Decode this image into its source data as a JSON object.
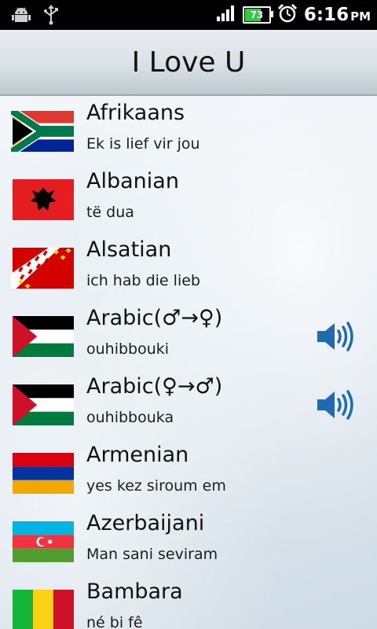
{
  "status_bar": {
    "time": "6:16",
    "ampm": "PM",
    "battery_level": "73",
    "icons": [
      "android-debug-icon",
      "usb-icon",
      "signal-icon",
      "battery-icon",
      "alarm-icon"
    ]
  },
  "app": {
    "title": "I Love U"
  },
  "languages": [
    {
      "name": "Afrikaans",
      "phrase": "Ek is lief vir jou",
      "flag": "south-africa",
      "audio": false
    },
    {
      "name": "Albanian",
      "phrase": "të dua",
      "flag": "albania",
      "audio": false
    },
    {
      "name": "Alsatian",
      "phrase": "ich hab die lieb",
      "flag": "alsace",
      "audio": false
    },
    {
      "name": "Arabic(♂→♀)",
      "phrase": "ouhibbouki",
      "flag": "palestine",
      "audio": true
    },
    {
      "name": "Arabic(♀→♂)",
      "phrase": "ouhibbouka",
      "flag": "palestine",
      "audio": true
    },
    {
      "name": "Armenian",
      "phrase": "yes kez siroum em",
      "flag": "armenia",
      "audio": false
    },
    {
      "name": "Azerbaijani",
      "phrase": "Man sani seviram",
      "flag": "azerbaijan",
      "audio": false
    },
    {
      "name": "Bambara",
      "phrase": "né bi fê",
      "flag": "mali",
      "audio": false
    }
  ],
  "colors": {
    "status_bar": "#000000",
    "title_text": "#111111",
    "speaker": "#1e6bb0"
  }
}
